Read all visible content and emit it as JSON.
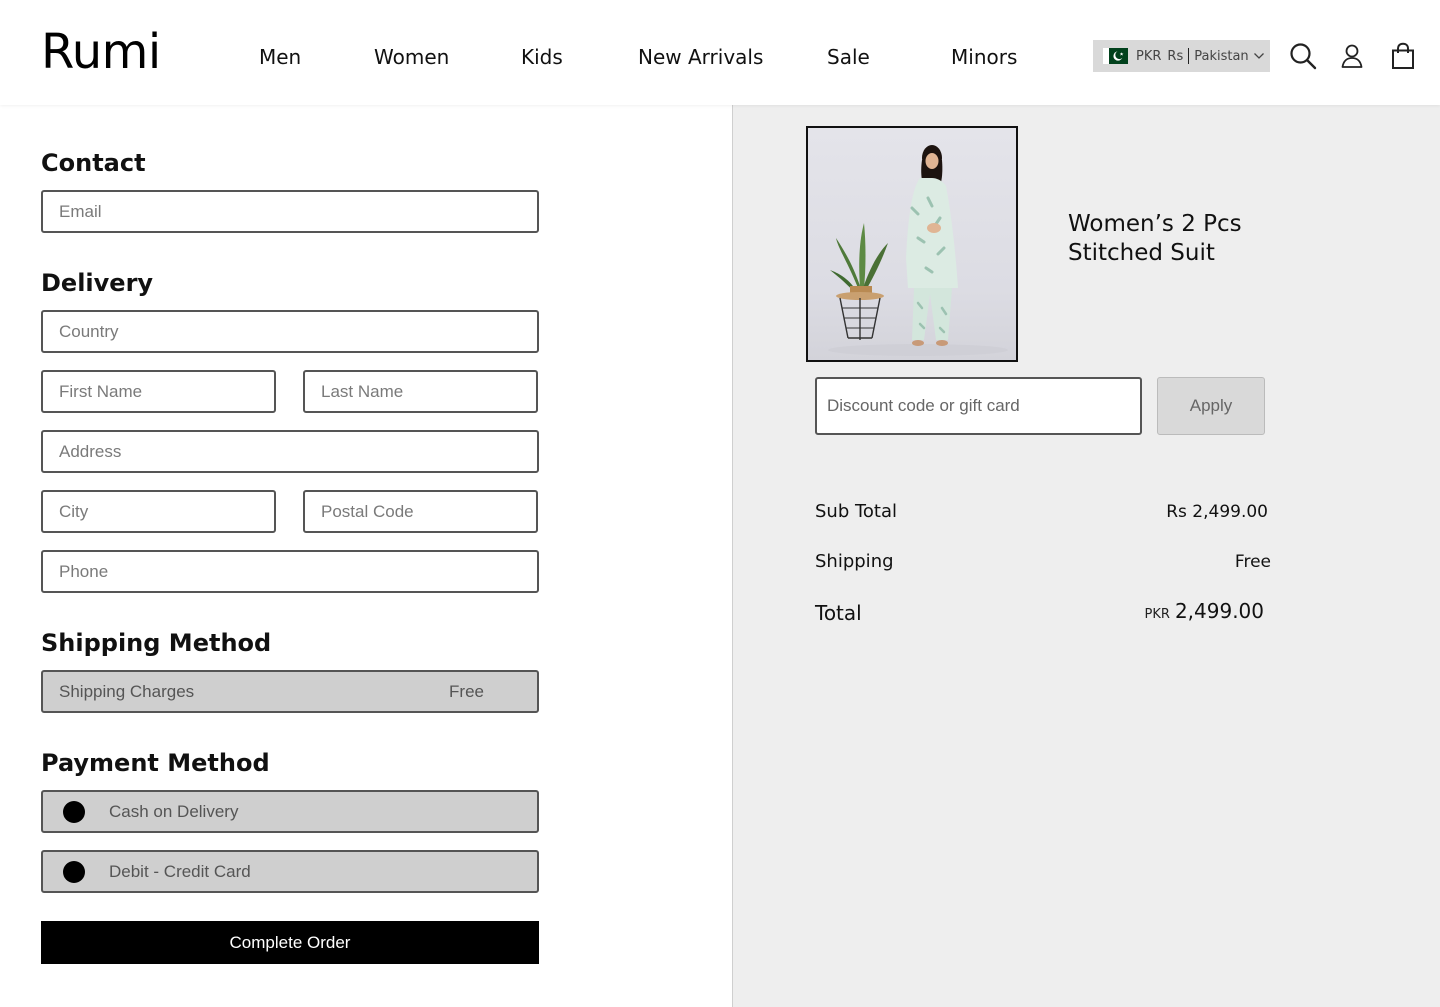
{
  "header": {
    "logo": "Rumi",
    "nav": [
      "Men",
      "Women",
      "Kids",
      "New Arrivals",
      "Sale",
      "Minors"
    ],
    "locale": {
      "currency_code": "PKR",
      "currency_symbol": "Rs",
      "country": "Pakistan"
    },
    "icons": [
      "search-icon",
      "account-icon",
      "cart-icon"
    ]
  },
  "contact": {
    "title": "Contact",
    "email_placeholder": "Email"
  },
  "delivery": {
    "title": "Delivery",
    "country_placeholder": "Country",
    "first_name_placeholder": "First Name",
    "last_name_placeholder": "Last Name",
    "address_placeholder": "Address",
    "city_placeholder": "City",
    "postal_code_placeholder": "Postal Code",
    "phone_placeholder": "Phone"
  },
  "shipping_method": {
    "title": "Shipping Method",
    "label": "Shipping Charges",
    "value": "Free"
  },
  "payment_method": {
    "title": "Payment Method",
    "options": [
      "Cash on Delivery",
      "Debit - Credit Card"
    ]
  },
  "complete_order_label": "Complete Order",
  "order_summary": {
    "product_title": "Women’s 2 Pcs Stitched Suit",
    "discount_placeholder": "Discount code or gift card",
    "apply_label": "Apply",
    "subtotal_label": "Sub Total",
    "subtotal_value": "Rs 2,499.00",
    "shipping_label": "Shipping",
    "shipping_value": "Free",
    "total_label": "Total",
    "total_currency": "PKR",
    "total_value": "2,499.00"
  },
  "colors": {
    "accent": "#000000",
    "summary_bg": "#eeeeee",
    "option_bg": "#cfcfcf",
    "flag_green": "#01411c"
  }
}
